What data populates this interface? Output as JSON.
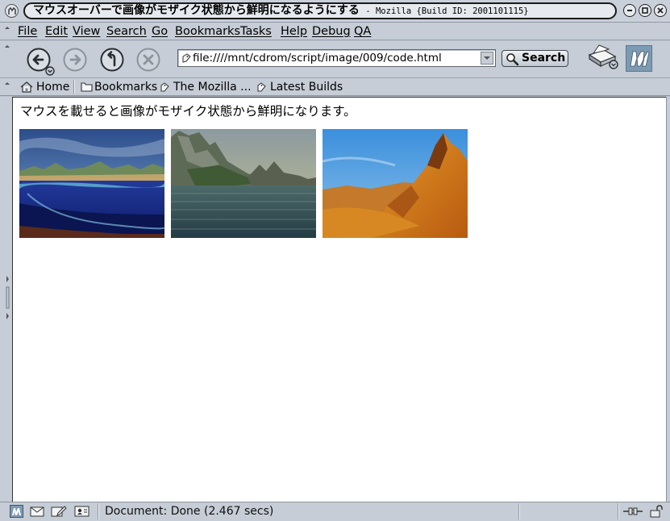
{
  "window": {
    "title": "マウスオーバーで画像がモザイク状態から鮮明になるようにする",
    "subtitle": "- Mozilla {Build ID: 2001101115}"
  },
  "menu": [
    "File",
    "Edit",
    "View",
    "Search",
    "Go",
    "Bookmarks",
    "Tasks",
    "Help",
    "Debug",
    "QA"
  ],
  "nav": {
    "url": "file:////mnt/cdrom/script/image/009/code.html",
    "search_label": "Search"
  },
  "personal_toolbar": {
    "home": "Home",
    "bookmarks": "Bookmarks",
    "mozilla": "The Mozilla ...",
    "latest_builds": "Latest Builds"
  },
  "page": {
    "text": "マウスを載せると画像がモザイク状態から鮮明になります。"
  },
  "status": {
    "text": "Document: Done (2.467 secs)"
  },
  "colors": {
    "chrome": "#c6cdd6",
    "chrome_dark": "#98a2ae",
    "content_bg": "#ffffff"
  }
}
